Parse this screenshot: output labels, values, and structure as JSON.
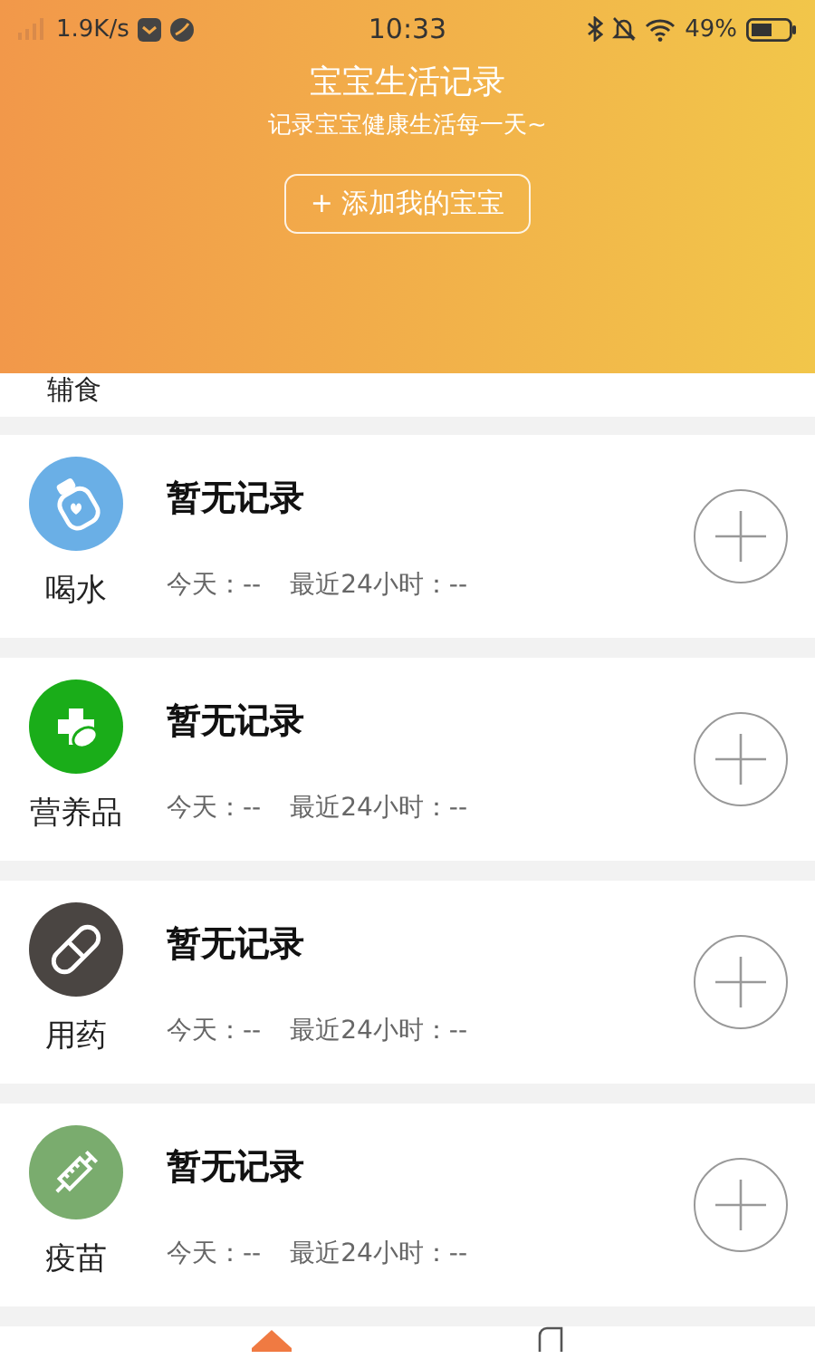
{
  "status_bar": {
    "speed": "1.9K/s",
    "time": "10:33",
    "battery": "49%"
  },
  "header": {
    "title": "宝宝生活记录",
    "subtitle": "记录宝宝健康生活每一天~",
    "add_button": "+ 添加我的宝宝"
  },
  "partial_category": "辅食",
  "categories": [
    {
      "name": "喝水",
      "kind": "bottle",
      "color": "#6aafe6",
      "record": "暂无记录",
      "today": "今天：--",
      "last24h": "最近24小时：--"
    },
    {
      "name": "营养品",
      "kind": "leaf",
      "color": "#1aad19",
      "record": "暂无记录",
      "today": "今天：--",
      "last24h": "最近24小时：--"
    },
    {
      "name": "用药",
      "kind": "pill",
      "color": "#4a4542",
      "record": "暂无记录",
      "today": "今天：--",
      "last24h": "最近24小时：--"
    },
    {
      "name": "疫苗",
      "kind": "syringe",
      "color": "#7aac6e",
      "record": "暂无记录",
      "today": "今天：--",
      "last24h": "最近24小时：--"
    }
  ]
}
